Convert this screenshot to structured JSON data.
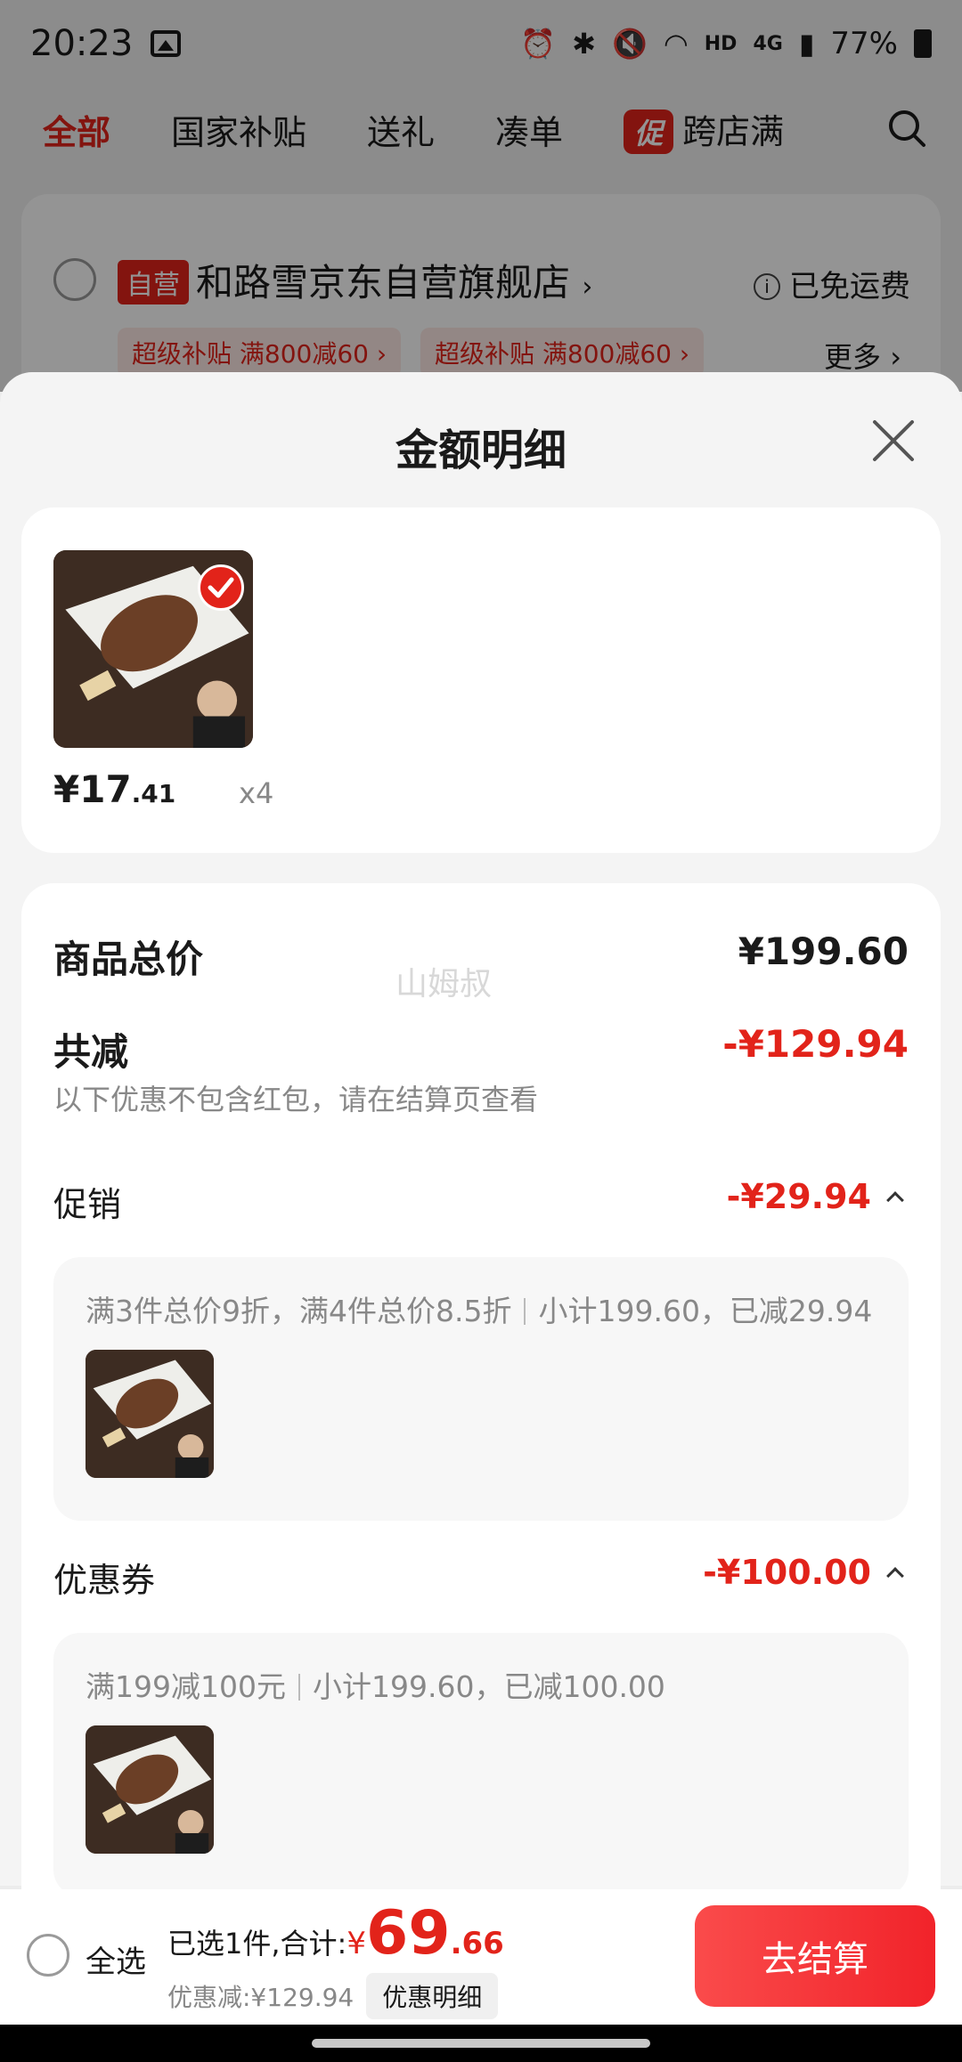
{
  "status_bar": {
    "time": "20:23",
    "net_label": "HD",
    "signal_label": "4G",
    "battery_text": "77%"
  },
  "category_tabs": [
    {
      "label": "全部",
      "active": true
    },
    {
      "label": "国家补贴",
      "active": false
    },
    {
      "label": "送礼",
      "active": false
    },
    {
      "label": "凑单",
      "active": false
    }
  ],
  "promo_tab": {
    "badge": "促",
    "label": "跨店满"
  },
  "store": {
    "badge": "自营",
    "name": "和路雪京东自营旗舰店",
    "shipping": "已免运费",
    "chips": [
      "超级补贴 满800减60",
      "超级补贴 满800减60"
    ],
    "more": "更多"
  },
  "sheet": {
    "title": "金额明细",
    "product": {
      "price_int": "¥17",
      "price_dec": ".41",
      "quantity": "x4"
    },
    "watermark": "山姆叔",
    "total_label": "商品总价",
    "total_value": "¥199.60",
    "reduce_label": "共减",
    "reduce_value": "-¥129.94",
    "reduce_note": "以下优惠不包含红包，请在结算页查看",
    "promo": {
      "label": "促销",
      "value": "-¥29.94",
      "desc": "满3件总价9折，满4件总价8.5折",
      "subtotal": "小计199.60，已减29.94"
    },
    "coupon": {
      "label": "优惠券",
      "value": "-¥100.00",
      "desc": "满199减100元",
      "subtotal": "小计199.60，已减100.00"
    }
  },
  "bottom_bar": {
    "select_all": "全选",
    "selected_text": "已选1件,合计:",
    "total_yen": "¥",
    "total_int": "69",
    "total_dec": ".66",
    "discount_text": "优惠减:¥129.94",
    "detail_label": "优惠明细",
    "checkout_label": "去结算"
  },
  "colors": {
    "accent": "#e2231a",
    "checkout": "#f1232a",
    "sheet_bg": "#f4f4f4"
  }
}
